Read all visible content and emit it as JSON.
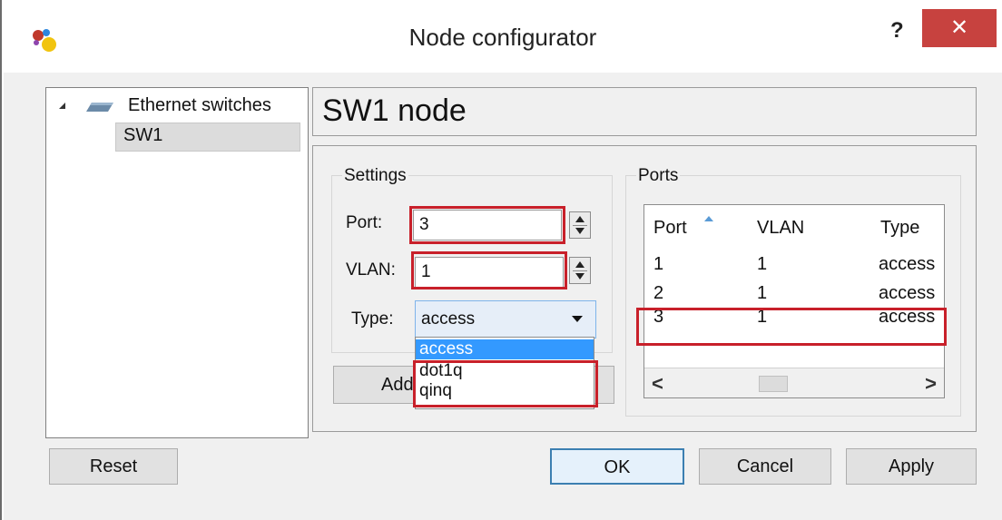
{
  "window": {
    "title": "Node configurator",
    "help_label": "?",
    "close_label": "✕"
  },
  "tree": {
    "root_label": "Ethernet switches",
    "child_label": "SW1"
  },
  "node_title": "SW1 node",
  "settings": {
    "group_label": "Settings",
    "port_label": "Port:",
    "port_value": "3",
    "vlan_label": "VLAN:",
    "vlan_value": "1",
    "type_label": "Type:",
    "type_value": "access",
    "type_options": [
      "access",
      "dot1q",
      "qinq"
    ],
    "add_button_label": "Add"
  },
  "ports": {
    "group_label": "Ports",
    "columns": [
      "Port",
      "VLAN",
      "Type"
    ],
    "rows": [
      [
        "1",
        "1",
        "access"
      ],
      [
        "2",
        "1",
        "access"
      ],
      [
        "3",
        "1",
        "access"
      ]
    ],
    "scroll_left": "<",
    "scroll_right": ">"
  },
  "buttons": {
    "reset": "Reset",
    "ok": "OK",
    "cancel": "Cancel",
    "apply": "Apply"
  },
  "colors": {
    "highlight_red": "#c8202a",
    "selection_blue": "#3399ff",
    "close_red": "#c7423f"
  }
}
